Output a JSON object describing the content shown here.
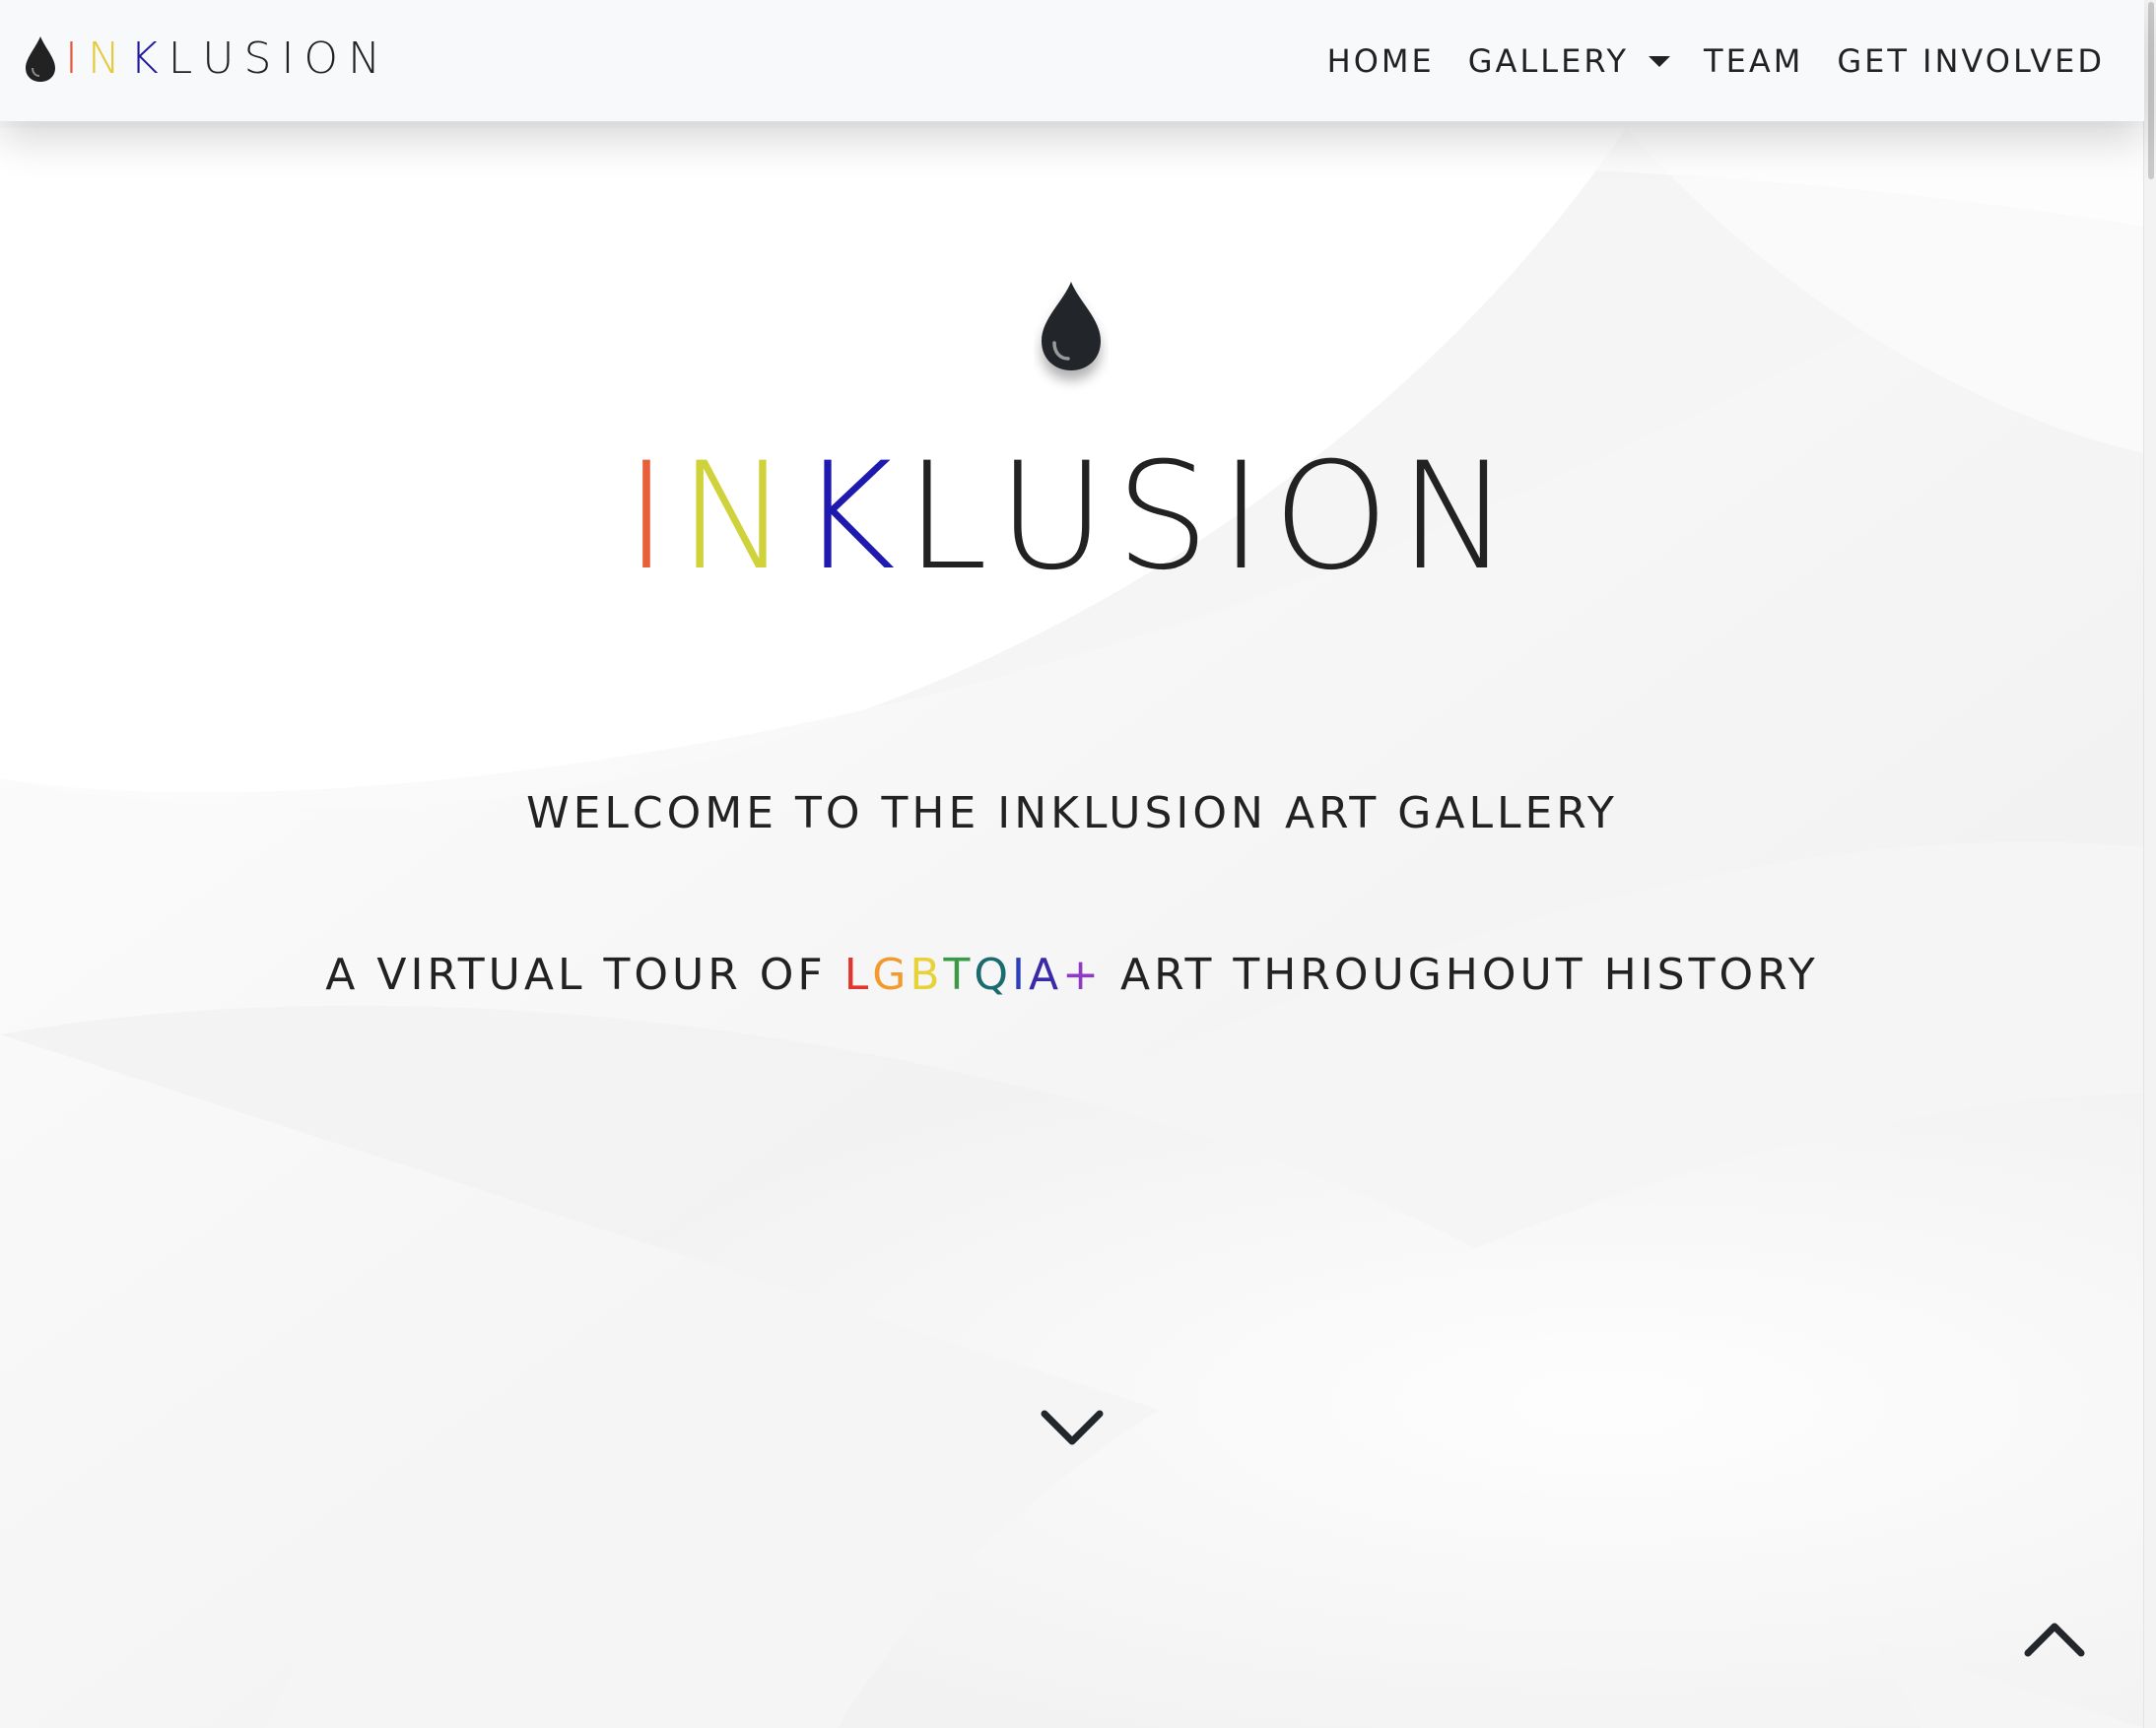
{
  "brand": {
    "letters": [
      "I",
      "N",
      "K",
      "L",
      "U",
      "S",
      "I",
      "O",
      "N"
    ],
    "letter_colors": [
      "#e8553a",
      "#e6c93a",
      "#1f1a9c",
      "#222222",
      "#222222",
      "#222222",
      "#222222",
      "#222222",
      "#222222"
    ],
    "icon": "ink-drop-icon"
  },
  "nav": {
    "home": "HOME",
    "gallery": "GALLERY",
    "team": "TEAM",
    "get_involved": "GET INVOLVED"
  },
  "hero": {
    "title_letters": [
      "I",
      "N",
      "K",
      "L",
      "U",
      "S",
      "I",
      "O",
      "N"
    ],
    "title_colors": [
      "#e8603a",
      "#cfd23a",
      "#1e1ab0",
      "#222222",
      "#222222",
      "#222222",
      "#222222",
      "#222222",
      "#222222"
    ],
    "welcome": "WELCOME TO THE INKLUSION ART GALLERY",
    "tagline_before": "A VIRTUAL TOUR OF ",
    "tagline_highlight": [
      "L",
      "G",
      "B",
      "T",
      "Q",
      "I",
      "A",
      "+"
    ],
    "tagline_highlight_colors": [
      "#e0362c",
      "#f29a2e",
      "#e8d23a",
      "#3a9a4a",
      "#1a6a6e",
      "#2a40b8",
      "#3a2aa8",
      "#8e3ac2"
    ],
    "tagline_after": " ART THROUGHOUT HISTORY",
    "drop_icon": "ink-drop-icon",
    "scroll_icon": "chevron-down-icon",
    "top_icon": "chevron-up-icon"
  },
  "colors": {
    "text": "#222222",
    "navbar_bg": "#f8f9fa",
    "hero_bg": "#f8f8f8"
  }
}
